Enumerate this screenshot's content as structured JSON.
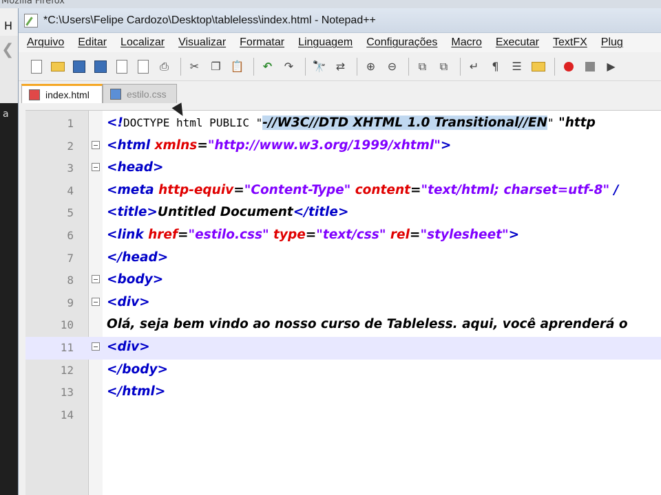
{
  "background": {
    "firefox_title": "Mozilla Firefox",
    "menu_hint": "H",
    "side_text": "a"
  },
  "window": {
    "title": "*C:\\Users\\Felipe Cardozo\\Desktop\\tableless\\index.html - Notepad++"
  },
  "menu": [
    "Arquivo",
    "Editar",
    "Localizar",
    "Visualizar",
    "Formatar",
    "Linguagem",
    "Configurações",
    "Macro",
    "Executar",
    "TextFX",
    "Plug"
  ],
  "toolbar_icons": [
    "new-file-icon",
    "open-folder-icon",
    "save-icon",
    "save-all-icon",
    "close-icon",
    "close-all-icon",
    "print-icon",
    "cut-icon",
    "copy-icon",
    "paste-icon",
    "undo-icon",
    "redo-icon",
    "find-icon",
    "replace-icon",
    "zoom-in-icon",
    "zoom-out-icon",
    "sync-vertical-icon",
    "sync-horizontal-icon",
    "word-wrap-icon",
    "show-all-chars-icon",
    "indent-guide-icon",
    "folder-as-workspace-icon",
    "record-macro-icon",
    "stop-macro-icon",
    "play-macro-icon"
  ],
  "tabs": [
    {
      "label": "index.html",
      "active": true
    },
    {
      "label": "estilo.css",
      "active": false
    }
  ],
  "code": {
    "line_numbers": [
      "1",
      "2",
      "3",
      "4",
      "5",
      "6",
      "7",
      "8",
      "9",
      "10",
      "11",
      "12",
      "13",
      "14"
    ],
    "l1": {
      "open": "<",
      "bang": "!",
      "doctype": "DOCTYPE html PUBLIC ",
      "q": "\"",
      "dtd": "-//W3C//DTD XHTML 1.0 Transitional//EN",
      "q2": "\"",
      "rest": " \"http"
    },
    "l2": {
      "open": "<html ",
      "attr": "xmlns",
      "eq": "=",
      "val": "\"http://www.w3.org/1999/xhtml\"",
      "close": ">"
    },
    "l3": {
      "tag": "<head>"
    },
    "l4": {
      "open": "<meta ",
      "a1": "http-equiv",
      "eq1": "=",
      "v1": "\"Content-Type\"",
      "a2": " content",
      "eq2": "=",
      "v2": "\"text/html; charset=utf-8\"",
      "tail": " /"
    },
    "l5": {
      "open": "<title>",
      "text": "Untitled Document",
      "close": "</title>"
    },
    "l6": {
      "open": "<link ",
      "a1": "href",
      "eq1": "=",
      "v1": "\"estilo.css\"",
      "a2": " type",
      "eq2": "=",
      "v2": "\"text/css\"",
      "a3": " rel",
      "eq3": "=",
      "v3": "\"stylesheet\"",
      "close": ">"
    },
    "l7": {
      "tag": "</head>"
    },
    "l8": {
      "tag": "<body>"
    },
    "l9": {
      "tag": "<div>"
    },
    "l10": {
      "text": "Olá, seja bem vindo ao nosso curso de Tableless. aqui, você aprenderá o"
    },
    "l11": {
      "tag": "<div>"
    },
    "l12": {
      "tag": "</body>"
    },
    "l13": {
      "tag": "</html>"
    },
    "l14": {
      "tag": ""
    }
  }
}
